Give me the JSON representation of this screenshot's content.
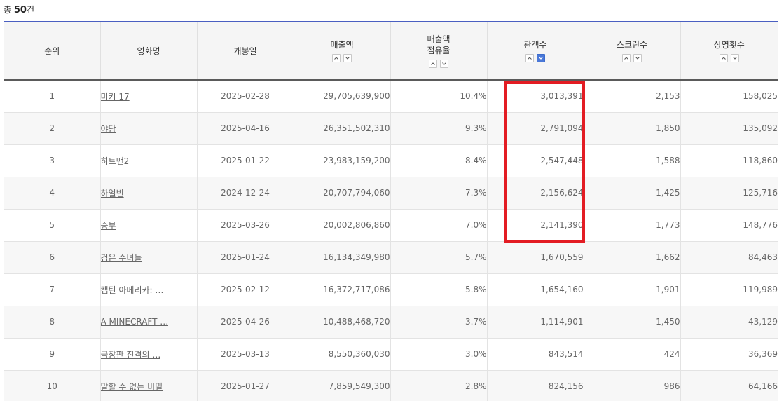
{
  "summary": {
    "prefix": "총",
    "count": "50",
    "suffix": "건"
  },
  "columns": {
    "rank": "순위",
    "title": "영화명",
    "release": "개봉일",
    "sales": "매출액",
    "share_line1": "매출액",
    "share_line2": "점유율",
    "audience": "관객수",
    "screens": "스크린수",
    "shows": "상영횟수"
  },
  "sort": {
    "active_column": "audience",
    "active_direction": "desc",
    "active_color": "#4a78d8"
  },
  "highlight": {
    "color": "#e31c23",
    "column": "audience",
    "rows": [
      1,
      2,
      3,
      4,
      5
    ]
  },
  "rows": [
    {
      "rank": "1",
      "title": "미키 17",
      "release": "2025-02-28",
      "sales": "29,705,639,900",
      "share": "10.4%",
      "audience": "3,013,391",
      "screens": "2,153",
      "shows": "158,025"
    },
    {
      "rank": "2",
      "title": "야당",
      "release": "2025-04-16",
      "sales": "26,351,502,310",
      "share": "9.3%",
      "audience": "2,791,094",
      "screens": "1,850",
      "shows": "135,092"
    },
    {
      "rank": "3",
      "title": "히트맨2",
      "release": "2025-01-22",
      "sales": "23,983,159,200",
      "share": "8.4%",
      "audience": "2,547,448",
      "screens": "1,588",
      "shows": "118,860"
    },
    {
      "rank": "4",
      "title": "하얼빈",
      "release": "2024-12-24",
      "sales": "20,707,794,060",
      "share": "7.3%",
      "audience": "2,156,624",
      "screens": "1,425",
      "shows": "125,716"
    },
    {
      "rank": "5",
      "title": "승부",
      "release": "2025-03-26",
      "sales": "20,002,806,860",
      "share": "7.0%",
      "audience": "2,141,390",
      "screens": "1,773",
      "shows": "148,776"
    },
    {
      "rank": "6",
      "title": "검은 수녀들",
      "release": "2025-01-24",
      "sales": "16,134,349,980",
      "share": "5.7%",
      "audience": "1,670,559",
      "screens": "1,662",
      "shows": "84,463"
    },
    {
      "rank": "7",
      "title": "캡틴 아메리카: …",
      "release": "2025-02-12",
      "sales": "16,372,717,086",
      "share": "5.8%",
      "audience": "1,654,160",
      "screens": "1,901",
      "shows": "119,989"
    },
    {
      "rank": "8",
      "title": "A MINECRAFT …",
      "release": "2025-04-26",
      "sales": "10,488,468,720",
      "share": "3.7%",
      "audience": "1,114,901",
      "screens": "1,450",
      "shows": "43,129"
    },
    {
      "rank": "9",
      "title": "극장판 진격의 …",
      "release": "2025-03-13",
      "sales": "8,550,360,030",
      "share": "3.0%",
      "audience": "843,514",
      "screens": "424",
      "shows": "36,369"
    },
    {
      "rank": "10",
      "title": "말할 수 없는 비밀",
      "release": "2025-01-27",
      "sales": "7,859,549,300",
      "share": "2.8%",
      "audience": "824,156",
      "screens": "986",
      "shows": "64,166"
    }
  ]
}
